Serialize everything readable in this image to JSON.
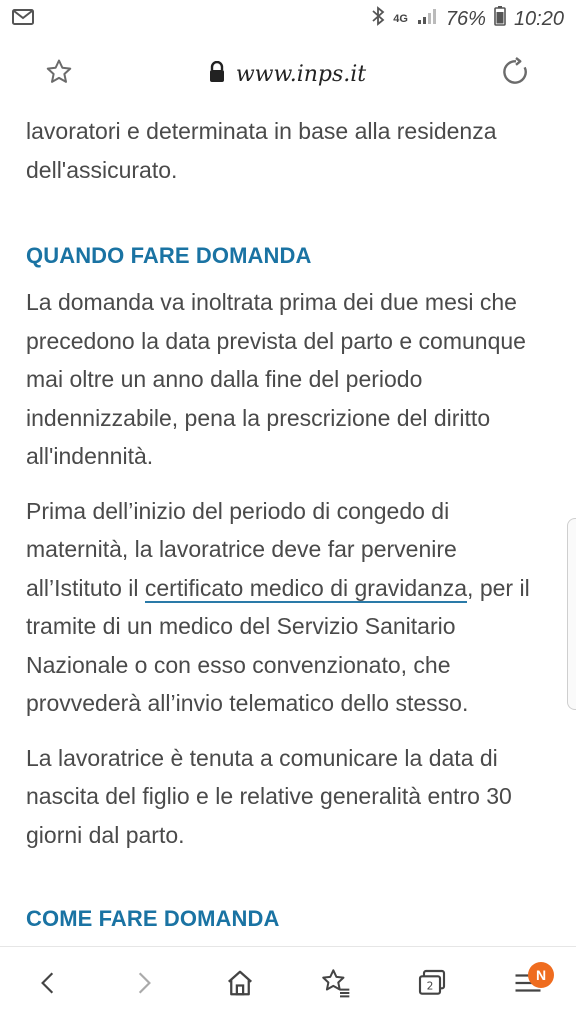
{
  "status_bar": {
    "network": "4G",
    "battery": "76%",
    "time": "10:20",
    "icons": [
      "gmail-icon",
      "bluetooth-icon",
      "signal-icon",
      "battery-icon"
    ]
  },
  "address_bar": {
    "url": "www.inps.it"
  },
  "content": {
    "para0": "lavoratori e determinata in base alla residenza dell'assicurato.",
    "heading1": "QUANDO FARE DOMANDA",
    "para1": "La domanda va inoltrata prima dei due mesi che precedono la data prevista del parto e comunque mai oltre un anno dalla fine del periodo indennizzabile, pena la prescrizione del diritto all'indennità.",
    "para2_before": "Prima dell’inizio del periodo di congedo di maternità, la lavoratrice deve far pervenire all’Istituto il ",
    "para2_link": "certificato medico di gravidanza",
    "para2_after": ", per il tramite di un medico del Servizio Sanitario Nazionale o con esso convenzionato, che provvederà all’invio telematico dello stesso.",
    "para3": "La lavoratrice è tenuta a comunicare la data di nascita del figlio e le relative generalità entro 30 giorni dal parto.",
    "heading2": "COME FARE DOMANDA"
  },
  "bottom_bar": {
    "badge": "N",
    "colors": {
      "accent": "#1a73a3",
      "badge": "#ef6c1f"
    }
  }
}
